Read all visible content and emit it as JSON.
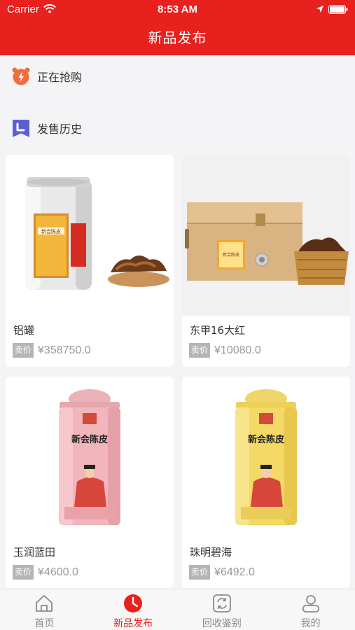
{
  "status": {
    "carrier": "Carrier",
    "time": "8:53 AM"
  },
  "nav": {
    "title": "新品发布"
  },
  "sections": {
    "buying": "正在抢购",
    "history": "发售历史"
  },
  "products": [
    {
      "name": "铝罐",
      "tag": "卖价",
      "price": "¥358750.0"
    },
    {
      "name": "东甲16大红",
      "tag": "卖价",
      "price": "¥10080.0"
    },
    {
      "name": "玉润蓝田",
      "tag": "卖价",
      "price": "¥4600.0"
    },
    {
      "name": "珠明碧海",
      "tag": "卖价",
      "price": "¥6492.0"
    }
  ],
  "product_art": {
    "can_lid_text": "新会陈皮",
    "pink_can_title": "新会陈皮",
    "yellow_can_title": "新会陈皮",
    "box_label": "新会陈皮"
  },
  "tabs": [
    {
      "label": "首页",
      "icon": "home-icon"
    },
    {
      "label": "新品发布",
      "icon": "clock-icon",
      "active": true
    },
    {
      "label": "回收鉴别",
      "icon": "recycle-icon"
    },
    {
      "label": "我的",
      "icon": "user-icon"
    }
  ],
  "colors": {
    "brand": "#e8201e",
    "section_icon_orange": "#f36b3c",
    "section_icon_purple": "#5b5fd6"
  }
}
